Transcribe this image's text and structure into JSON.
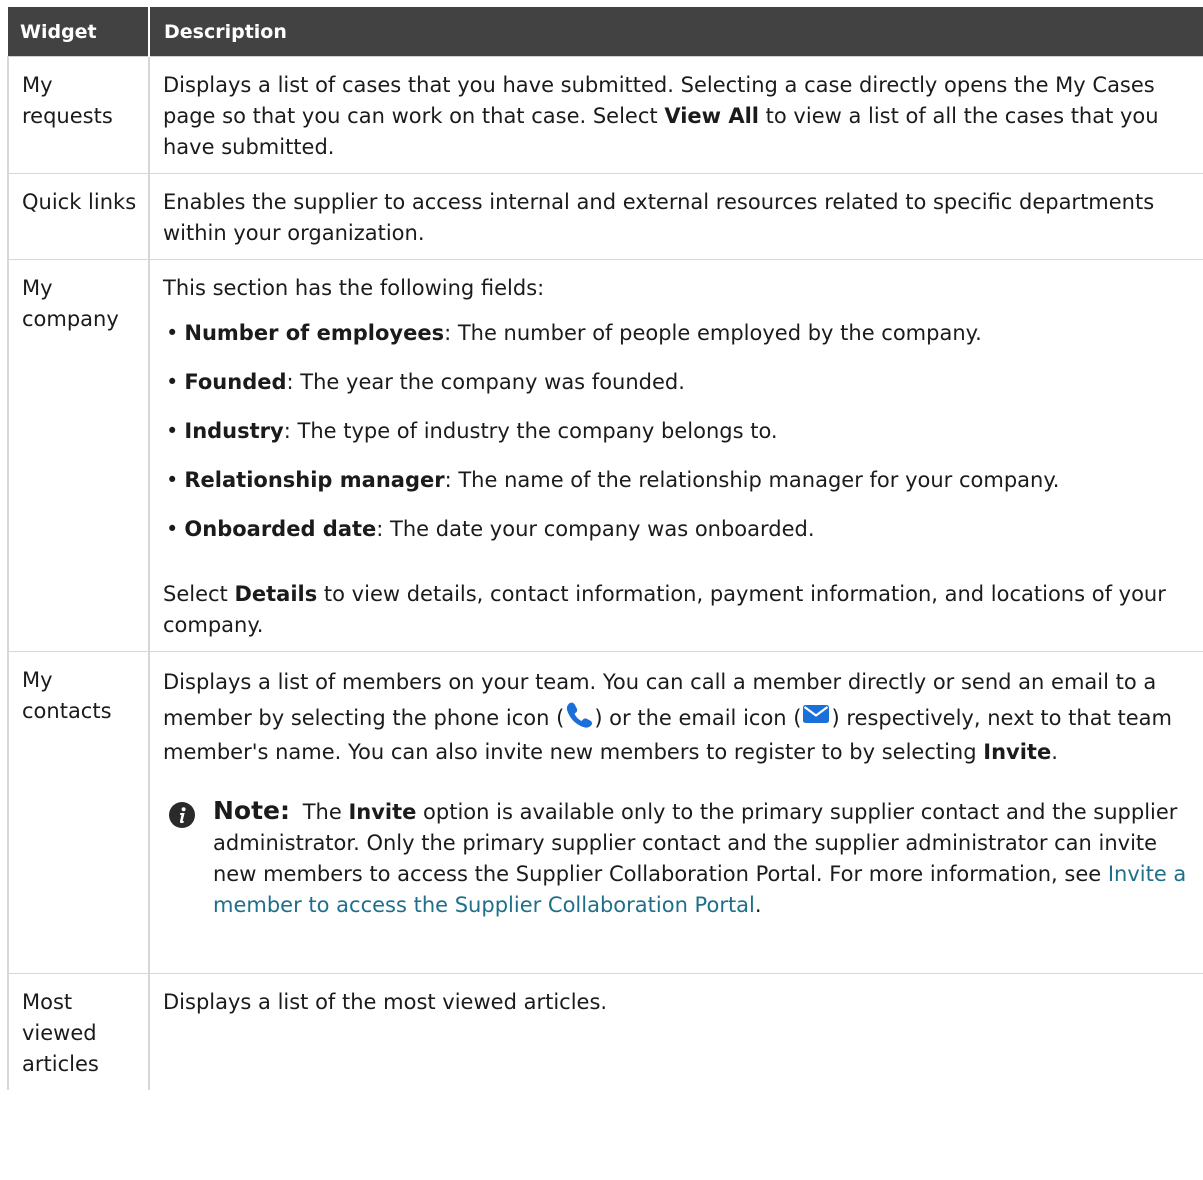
{
  "table": {
    "header": {
      "widget": "Widget",
      "description": "Description"
    },
    "rows": {
      "my_requests": {
        "widget": "My requests",
        "text_1": "Displays a list of cases that you have submitted. Selecting a case directly opens the My Cases page so that you can work on that case. Select ",
        "bold_1": "View All",
        "text_2": " to view a list of all the cases that you have submitted."
      },
      "quick_links": {
        "widget": "Quick links",
        "text": "Enables the supplier to access internal and external resources related to specific departments within your organization."
      },
      "my_company": {
        "widget": "My company",
        "intro": "This section has the following fields:",
        "fields": [
          {
            "label": "Number of employees",
            "text": ": The number of people employed by the company."
          },
          {
            "label": "Founded",
            "text": ": The year the company was founded."
          },
          {
            "label": "Industry",
            "text": ": The type of industry the company belongs to."
          },
          {
            "label": "Relationship manager",
            "text": ": The name of the relationship manager for your company."
          },
          {
            "label": "Onboarded date",
            "text": ": The date your company was onboarded."
          }
        ],
        "after_1": "Select ",
        "after_bold": "Details",
        "after_2": " to view details, contact information, payment information, and locations of your company."
      },
      "my_contacts": {
        "widget": "My contacts",
        "text_1": "Displays a list of members on your team. You can call a member directly or send an email to a member by selecting the phone icon (",
        "phone_icon": "phone-icon",
        "text_2": ") or the email icon (",
        "email_icon": "email-icon",
        "text_3": ") respectively, next to that team member's name. You can also invite new members to register to by selecting ",
        "bold_invite": "Invite",
        "text_4": ".",
        "note": {
          "icon": "info-icon",
          "title": "Note:",
          "text_1": " The ",
          "bold": "Invite",
          "text_2": " option is available only to the primary supplier contact and the supplier administrator. Only the primary supplier contact and the supplier administrator can invite new members to access the Supplier Collaboration Portal. For more information, see ",
          "link": "Invite a member to access the Supplier Collaboration Portal",
          "text_3": "."
        }
      },
      "most_viewed": {
        "widget": "Most viewed articles",
        "text": "Displays a list of the most viewed articles."
      }
    }
  },
  "colors": {
    "header_bg": "#424242",
    "header_text": "#ffffff",
    "link": "#1f6f8b",
    "phone_icon": "#1a6fd8",
    "email_icon": "#1a6fd8"
  }
}
